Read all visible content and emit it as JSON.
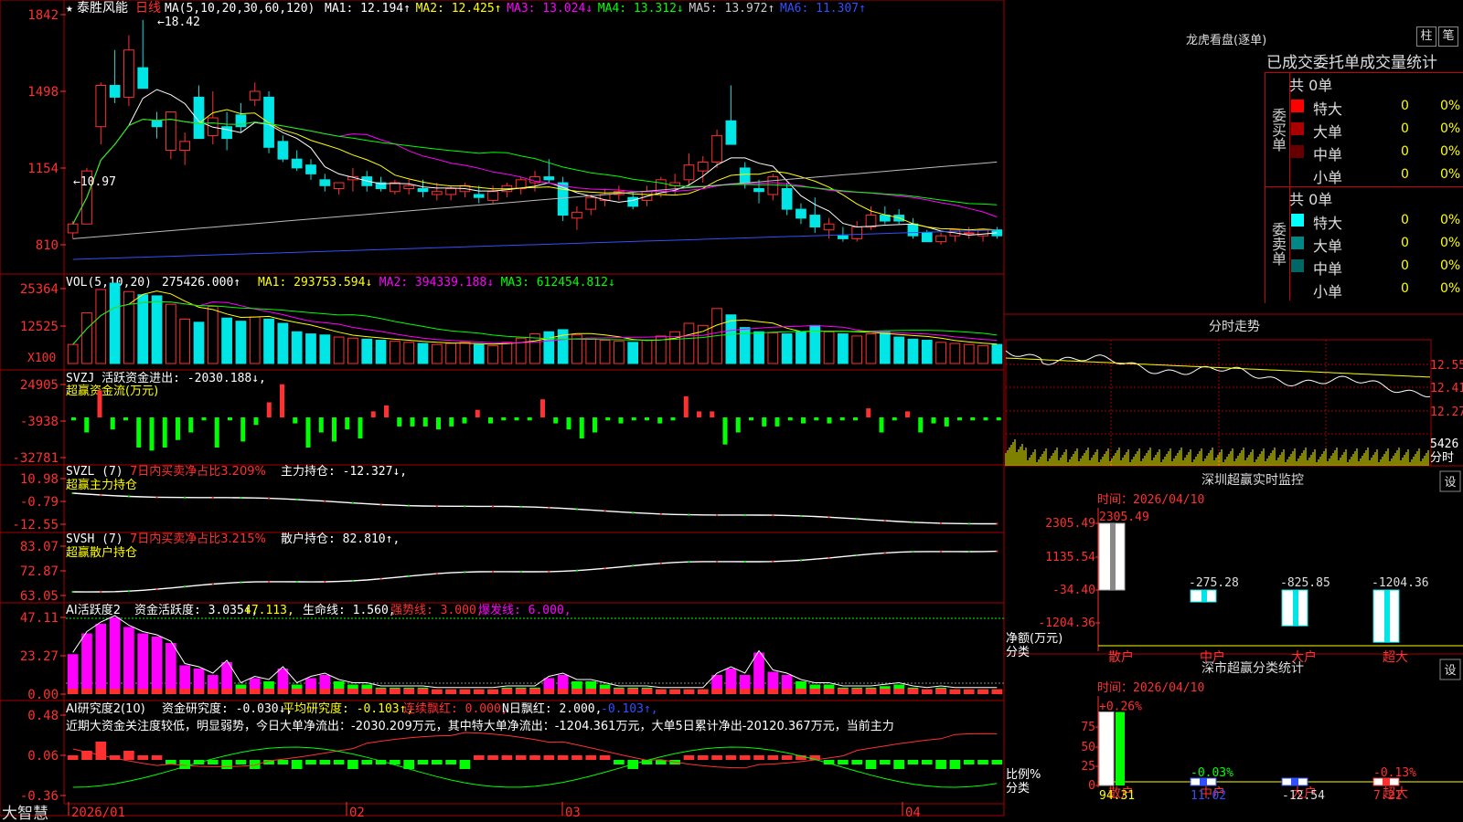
{
  "colors": {
    "up": "#ff3030",
    "down": "#00e5e5",
    "green": "#00ff00",
    "yellow": "#ffff00",
    "magenta": "#ff00ff",
    "white": "#ffffff",
    "blue": "#3050ff",
    "grid": "#aa0000"
  },
  "kline": {
    "stock_name": "泰胜风能",
    "period": "日线",
    "legend": {
      "prefix": "MA(5,10,20,30,60,120)",
      "items": [
        {
          "label": "MA1:",
          "value": "12.194",
          "arrow": "↑",
          "color": "#ffffff"
        },
        {
          "label": "MA2:",
          "value": "12.425",
          "arrow": "↑",
          "color": "#ffff00"
        },
        {
          "label": "MA3:",
          "value": "13.024",
          "arrow": "↓",
          "color": "#ff00ff"
        },
        {
          "label": "MA4:",
          "value": "13.312",
          "arrow": "↓",
          "color": "#00ff00"
        },
        {
          "label": "MA5:",
          "value": "13.972",
          "arrow": "↑",
          "color": "#cccccc"
        },
        {
          "label": "MA6:",
          "value": "11.307",
          "arrow": "↑",
          "color": "#3050ff"
        }
      ]
    },
    "y_ticks": [
      "1842",
      "1498",
      "1154",
      "810"
    ],
    "max_label": "18.42",
    "min_label": "10.97",
    "candles": [
      [
        11.2,
        11.6,
        11.0,
        11.5
      ],
      [
        11.5,
        13.4,
        11.5,
        13.3
      ],
      [
        14.8,
        16.3,
        14.2,
        16.2
      ],
      [
        16.2,
        17.4,
        15.6,
        15.8
      ],
      [
        15.8,
        17.9,
        15.5,
        17.4
      ],
      [
        16.8,
        18.42,
        16.3,
        16.1
      ],
      [
        15.0,
        15.3,
        14.4,
        14.8
      ],
      [
        14.0,
        15.2,
        13.7,
        15.3
      ],
      [
        14.0,
        14.6,
        13.5,
        14.3
      ],
      [
        15.8,
        16.2,
        14.4,
        14.4
      ],
      [
        14.5,
        16.0,
        14.2,
        15.1
      ],
      [
        14.8,
        15.3,
        14.0,
        14.4
      ],
      [
        15.2,
        15.6,
        14.6,
        14.8
      ],
      [
        15.7,
        16.3,
        15.5,
        16.0
      ],
      [
        15.8,
        16.0,
        13.9,
        14.1
      ],
      [
        14.3,
        14.5,
        13.6,
        13.7
      ],
      [
        13.7,
        14.0,
        13.3,
        13.4
      ],
      [
        13.5,
        13.7,
        13.0,
        13.2
      ],
      [
        13.0,
        13.2,
        12.6,
        12.8
      ],
      [
        12.7,
        12.9,
        12.5,
        12.9
      ],
      [
        13.0,
        13.4,
        12.6,
        13.1
      ],
      [
        13.1,
        13.3,
        12.6,
        12.8
      ],
      [
        12.9,
        13.1,
        12.6,
        12.7
      ],
      [
        12.6,
        13.0,
        12.5,
        12.9
      ],
      [
        12.7,
        13.0,
        12.5,
        12.8
      ],
      [
        12.7,
        13.0,
        12.4,
        12.6
      ],
      [
        12.5,
        12.9,
        12.3,
        12.6
      ],
      [
        12.5,
        12.8,
        12.3,
        12.7
      ],
      [
        12.6,
        12.9,
        12.4,
        12.8
      ],
      [
        12.5,
        12.8,
        12.2,
        12.4
      ],
      [
        12.3,
        12.8,
        12.2,
        12.6
      ],
      [
        12.6,
        12.9,
        12.4,
        12.8
      ],
      [
        12.7,
        13.1,
        12.5,
        13.0
      ],
      [
        12.9,
        13.3,
        12.6,
        13.1
      ],
      [
        13.1,
        13.7,
        12.9,
        13.0
      ],
      [
        12.9,
        13.1,
        11.6,
        11.8
      ],
      [
        11.7,
        12.1,
        11.3,
        11.9
      ],
      [
        12.0,
        12.5,
        11.8,
        12.4
      ],
      [
        12.3,
        12.7,
        12.1,
        12.5
      ],
      [
        12.5,
        12.8,
        12.3,
        12.6
      ],
      [
        12.4,
        12.6,
        12.0,
        12.1
      ],
      [
        12.3,
        12.8,
        12.1,
        12.6
      ],
      [
        12.5,
        13.1,
        12.4,
        13.0
      ],
      [
        12.8,
        13.2,
        12.5,
        12.9
      ],
      [
        13.0,
        13.9,
        12.8,
        13.5
      ],
      [
        13.3,
        13.8,
        12.9,
        13.6
      ],
      [
        13.6,
        14.7,
        13.4,
        14.5
      ],
      [
        15.0,
        16.2,
        14.2,
        14.2
      ],
      [
        13.4,
        13.6,
        12.7,
        12.9
      ],
      [
        12.7,
        13.0,
        12.2,
        12.6
      ],
      [
        12.5,
        13.2,
        12.3,
        13.1
      ],
      [
        12.7,
        12.9,
        11.8,
        12.0
      ],
      [
        12.0,
        12.2,
        11.5,
        11.7
      ],
      [
        11.8,
        12.4,
        11.2,
        11.4
      ],
      [
        11.3,
        11.7,
        11.0,
        11.5
      ],
      [
        11.1,
        11.4,
        10.9,
        11.0
      ],
      [
        11.0,
        11.6,
        10.9,
        11.4
      ],
      [
        11.4,
        12.1,
        11.3,
        11.8
      ],
      [
        11.8,
        12.1,
        11.5,
        11.6
      ],
      [
        11.8,
        12.0,
        11.5,
        11.6
      ],
      [
        11.5,
        11.7,
        11.0,
        11.1
      ],
      [
        11.2,
        11.3,
        10.9,
        10.9
      ],
      [
        10.9,
        11.2,
        10.8,
        11.1
      ],
      [
        11.1,
        11.3,
        10.9,
        11.3
      ],
      [
        11.2,
        11.4,
        11.0,
        11.2
      ],
      [
        11.1,
        11.3,
        10.9,
        11.3
      ],
      [
        11.3,
        11.4,
        11.0,
        11.1
      ]
    ]
  },
  "volume": {
    "header": {
      "name": "VOL(5,10,20)",
      "value": "275426.000",
      "arrow": "↑",
      "mas": [
        {
          "label": "MA1:",
          "value": "293753.594",
          "arrow": "↓",
          "color": "#ffff00"
        },
        {
          "label": "MA2:",
          "value": "394339.188",
          "arrow": "↓",
          "color": "#ff00ff"
        },
        {
          "label": "MA3:",
          "value": "612454.812",
          "arrow": "↓",
          "color": "#00ff00"
        }
      ]
    },
    "y_ticks": [
      "25364",
      "12525"
    ],
    "unit": "X100",
    "values": [
      180,
      480,
      700,
      760,
      680,
      650,
      640,
      560,
      420,
      390,
      540,
      430,
      400,
      440,
      420,
      380,
      300,
      280,
      270,
      250,
      240,
      230,
      220,
      210,
      200,
      190,
      180,
      190,
      200,
      180,
      170,
      200,
      240,
      280,
      300,
      320,
      270,
      240,
      220,
      210,
      200,
      220,
      260,
      300,
      380,
      360,
      520,
      460,
      340,
      300,
      290,
      280,
      300,
      360,
      300,
      280,
      260,
      280,
      300,
      250,
      230,
      220,
      200,
      190,
      180,
      170,
      180
    ]
  },
  "svzj": {
    "header": {
      "name": "SVZJ",
      "title": "活跃资金进出:",
      "value": "-2030.188",
      "arrow": "↓",
      "sub": "超赢资金流(万元)"
    },
    "y_ticks": [
      "24905",
      "-3938",
      "-32781"
    ],
    "values": [
      -2,
      -10,
      18,
      -8,
      -2,
      -20,
      -22,
      -20,
      -15,
      -10,
      -2,
      -20,
      -2,
      -16,
      -5,
      10,
      22,
      -4,
      -20,
      -10,
      -16,
      -8,
      -14,
      4,
      8,
      -6,
      -6,
      -6,
      -8,
      -6,
      -4,
      5,
      -4,
      -2,
      -2,
      -2,
      12,
      -4,
      -8,
      -14,
      -10,
      -2,
      -4,
      -2,
      -2,
      -4,
      -2,
      14,
      4,
      4,
      -18,
      -10,
      -2,
      -6,
      -6,
      -2,
      -4,
      -2,
      -4,
      -2,
      -2,
      6,
      -10,
      -2,
      4,
      -10,
      -4,
      -6,
      -2,
      -2,
      -2,
      -2
    ]
  },
  "svzl": {
    "header": {
      "name": "SVZL",
      "params": "(7)",
      "desc": "7日内买卖净占比3.209%",
      "title": "主力持仓:",
      "value": "-12.327",
      "arrow": "↓",
      "sub": "超赢主力持仓"
    },
    "y_ticks": [
      "10.98",
      "-0.79",
      "-12.55"
    ]
  },
  "svsh": {
    "header": {
      "name": "SVSH",
      "params": "(7)",
      "desc": "7日内买卖净占比3.215%",
      "title": "散户持仓:",
      "value": "82.810",
      "arrow": "↑",
      "sub": "超赢散户持仓"
    },
    "y_ticks": [
      "83.07",
      "72.87",
      "63.05"
    ]
  },
  "ai_active": {
    "header": {
      "name": "AI活跃度2",
      "items": [
        {
          "label": "资金活跃度:",
          "value": "3.035",
          "arrow": "↑",
          "color": "#ffffff"
        },
        {
          "label": "",
          "value": "47.113",
          "arrow": "",
          "color": "#ffff00"
        },
        {
          "label": "生命线:",
          "value": "1.560",
          "arrow": "",
          "color": "#ffffff"
        },
        {
          "label": "强势线:",
          "value": "3.000",
          "arrow": "",
          "color": "#ff3030"
        },
        {
          "label": "爆发线:",
          "value": "6.000",
          "arrow": "",
          "color": "#ff00ff"
        }
      ]
    },
    "y_ticks": [
      "47.11",
      "23.27",
      "0.00"
    ],
    "values": [
      25,
      38,
      44,
      48,
      42,
      38,
      36,
      32,
      18,
      16,
      12,
      20,
      6,
      10,
      8,
      16,
      6,
      10,
      12,
      8,
      6,
      6,
      4,
      4,
      4,
      4,
      3,
      3,
      3,
      3,
      3,
      4,
      4,
      4,
      10,
      12,
      8,
      8,
      6,
      4,
      4,
      4,
      3,
      3,
      3,
      3,
      12,
      16,
      12,
      26,
      14,
      12,
      8,
      6,
      6,
      4,
      4,
      4,
      5,
      6,
      4,
      3,
      4,
      3,
      3,
      3,
      3
    ]
  },
  "ai_research": {
    "header": {
      "name": "AI研究度2(10)",
      "items": [
        {
          "label": "资金研究度:",
          "value": "-0.030",
          "arrow": "↓",
          "color": "#ffffff"
        },
        {
          "label": "平均研究度:",
          "value": "-0.103",
          "arrow": "↑",
          "color": "#ffff00"
        },
        {
          "label": "连续飘红:",
          "value": "0.000",
          "arrow": "",
          "color": "#ff3030"
        },
        {
          "label": "N日飘红:",
          "value": "2.000",
          "arrow": "",
          "color": "#ffffff"
        },
        {
          "label": "",
          "value": "-0.103",
          "arrow": "↑",
          "color": "#3050ff"
        }
      ]
    },
    "comment": "近期大资金关注度较低，明显弱势，今日大单净流出：-2030.209万元，其中特大单净流出：-1204.361万元，大单5日累计净出-20120.367万元，当前主力",
    "y_ticks": [
      "0.48",
      "0.06",
      "-0.36"
    ],
    "values": [
      1,
      2,
      4,
      1,
      2,
      1,
      1,
      -1,
      -2,
      -1,
      -1,
      -2,
      -1,
      -2,
      -1,
      -1,
      -2,
      -1,
      -1,
      -1,
      -2,
      -1,
      -1,
      -1,
      -2,
      -1,
      -1,
      -1,
      -2,
      1,
      1,
      1,
      1,
      1,
      1,
      1,
      1,
      1,
      1,
      -1,
      -2,
      -1,
      -1,
      -1,
      1,
      1,
      1,
      1,
      1,
      1,
      1,
      1,
      1,
      1,
      -1,
      -1,
      -1,
      -2,
      -1,
      -2,
      -1,
      -1,
      -2,
      -2,
      -1,
      -1,
      -1
    ]
  },
  "date_axis": {
    "labels": [
      "2026/01",
      "02",
      "03",
      "04"
    ],
    "left_label": "大智慧"
  },
  "dragon": {
    "title": "龙虎看盘(逐单)",
    "btn_bar": "柱",
    "btn_pen": "笔",
    "tab_label": "已成交委托单成交量统计",
    "buy": {
      "side": "委买单",
      "total": "共 0单",
      "rows": [
        {
          "name": "特大",
          "count": "0",
          "pct": "0%",
          "color": "#ff0000"
        },
        {
          "name": "大单",
          "count": "0",
          "pct": "0%",
          "color": "#aa0000"
        },
        {
          "name": "中单",
          "count": "0",
          "pct": "0%",
          "color": "#660000"
        },
        {
          "name": "小单",
          "count": "0",
          "pct": "0%",
          "color": "#000000"
        }
      ]
    },
    "sell": {
      "side": "委卖单",
      "total": "共 0单",
      "rows": [
        {
          "name": "特大",
          "count": "0",
          "pct": "0%",
          "color": "#00ffff"
        },
        {
          "name": "大单",
          "count": "0",
          "pct": "0%",
          "color": "#008888"
        },
        {
          "name": "中单",
          "count": "0",
          "pct": "0%",
          "color": "#006666"
        },
        {
          "name": "小单",
          "count": "0",
          "pct": "0%",
          "color": "#000000"
        }
      ]
    }
  },
  "timeshare": {
    "title": "分时走势",
    "y_ticks": [
      "12.55",
      "12.41",
      "12.27"
    ],
    "vol_label": "5426",
    "vol_unit": "分时"
  },
  "sz_monitor": {
    "title": "深圳超赢实时监控",
    "settings": "设",
    "date_label": "时间：2026/04/10",
    "y_ticks": [
      "2305.49",
      "1135.54",
      "-34.40",
      "-1204.36"
    ],
    "ylabel1": "净额(万元)",
    "ylabel2": "分类",
    "categories": [
      "散户",
      "中户",
      "大户",
      "超大"
    ],
    "values": [
      2305.49,
      -275.28,
      -825.85,
      -1204.36
    ],
    "value_labels": [
      "2305.49",
      "-275.28",
      "-825.85",
      "-1204.36"
    ]
  },
  "class_stats": {
    "title": "深市超赢分类统计",
    "settings": "设",
    "date_label": "时间：2026/04/10",
    "y_ticks": [
      "75",
      "50",
      "25",
      "0"
    ],
    "ylabel1": "比例%",
    "ylabel2": "分类",
    "categories": [
      "散户",
      "中户",
      "大户",
      "超大"
    ],
    "top_labels": [
      "+0.26%",
      "-0.03%",
      "",
      "-0.13%"
    ],
    "values": [
      94.31,
      11.02,
      -12.54,
      7.21
    ],
    "value_labels": [
      "94.31",
      "11.02",
      "-12.54",
      "7.21"
    ]
  }
}
